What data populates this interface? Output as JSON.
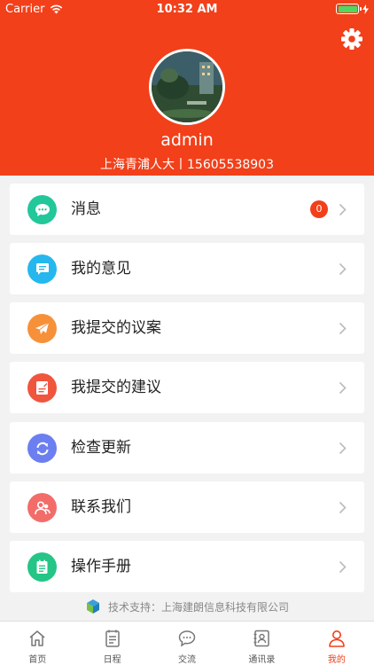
{
  "status_bar": {
    "carrier": "Carrier",
    "time": "10:32 AM"
  },
  "profile": {
    "username": "admin",
    "subtitle": "上海青浦人大丨15605538903"
  },
  "menu": [
    {
      "label": "消息",
      "icon": "message-icon",
      "color": "#22c79a",
      "badge": "0"
    },
    {
      "label": "我的意见",
      "icon": "opinion-icon",
      "color": "#26b7ee"
    },
    {
      "label": "我提交的议案",
      "icon": "send-icon",
      "color": "#f6913a"
    },
    {
      "label": "我提交的建议",
      "icon": "document-edit-icon",
      "color": "#f0553d"
    },
    {
      "label": "检查更新",
      "icon": "refresh-icon",
      "color": "#6c7ff0"
    },
    {
      "label": "联系我们",
      "icon": "contacts-icon",
      "color": "#f26d6a"
    },
    {
      "label": "操作手册",
      "icon": "notebook-icon",
      "color": "#24c586"
    }
  ],
  "footer": {
    "support_text": "技术支持：上海建朗信息科技有限公司"
  },
  "tabs": [
    {
      "label": "首页",
      "icon": "home-icon"
    },
    {
      "label": "日程",
      "icon": "calendar-icon"
    },
    {
      "label": "交流",
      "icon": "chat-icon"
    },
    {
      "label": "通讯录",
      "icon": "address-book-icon"
    },
    {
      "label": "我的",
      "icon": "person-icon",
      "active": true
    }
  ],
  "colors": {
    "accent": "#f2401a",
    "background": "#f2f2f2"
  }
}
